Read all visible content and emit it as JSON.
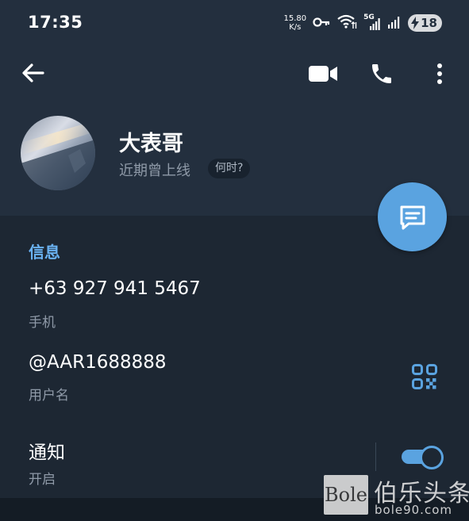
{
  "colors": {
    "background": "#1d2733",
    "header_background": "#232f3e",
    "accent": "#5aa3e0",
    "section_title": "#6ab2f2",
    "secondary_text": "#8f9aa8"
  },
  "status_bar": {
    "time": "17:35",
    "net_speed_value": "15.80",
    "net_speed_unit": "K/s",
    "key_icon": "key-icon",
    "wifi_icon": "wifi-icon",
    "signal_5g_label": "5G",
    "battery_level": "18"
  },
  "toolbar": {
    "back_icon": "arrow-left-icon",
    "video_icon": "video-camera-icon",
    "call_icon": "phone-icon",
    "more_icon": "more-vertical-icon"
  },
  "profile": {
    "name": "大表哥",
    "status": "近期曾上线",
    "when_button": "何时?"
  },
  "fab": {
    "icon": "message-icon"
  },
  "info": {
    "section_title": "信息",
    "phone_value": "+63 927 941 5467",
    "phone_label": "手机",
    "username_value": "@AAR1688888",
    "username_label": "用户名",
    "qr_icon": "qr-code-icon",
    "notifications_value": "通知",
    "notifications_label": "开启",
    "notifications_enabled": true
  },
  "watermark": {
    "logo_text": "Bole",
    "title": "伯乐头条",
    "url": "bole90.com"
  }
}
